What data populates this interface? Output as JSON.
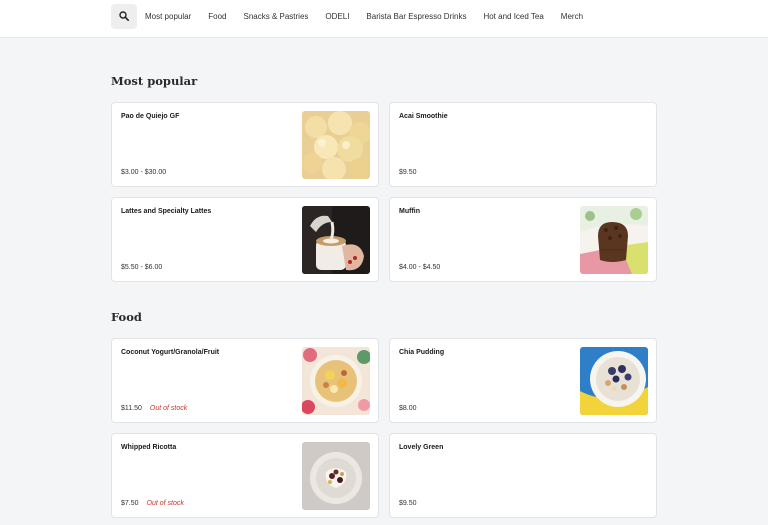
{
  "nav": {
    "items": [
      {
        "label": "Most popular"
      },
      {
        "label": "Food"
      },
      {
        "label": "Snacks & Pastries"
      },
      {
        "label": "ODELI"
      },
      {
        "label": "Barista Bar Espresso Drinks"
      },
      {
        "label": "Hot and Iced Tea"
      },
      {
        "label": "Merch"
      }
    ]
  },
  "sections": [
    {
      "title": "Most popular",
      "items": [
        {
          "name": "Pao de Quiejo GF",
          "price": "$3.00 - $30.00",
          "status": "",
          "image": "cheese-bread-photo"
        },
        {
          "name": "Acai Smoothie",
          "price": "$9.50",
          "status": "",
          "image": ""
        },
        {
          "name": "Lattes and Specialty Lattes",
          "price": "$5.50 - $6.00",
          "status": "",
          "image": "latte-photo"
        },
        {
          "name": "Muffin",
          "price": "$4.00 - $4.50",
          "status": "",
          "image": "muffin-photo"
        }
      ]
    },
    {
      "title": "Food",
      "items": [
        {
          "name": "Coconut Yogurt/Granola/Fruit",
          "price": "$11.50",
          "status": "Out of stock",
          "image": "yogurt-bowl-photo"
        },
        {
          "name": "Chia Pudding",
          "price": "$8.00",
          "status": "",
          "image": "chia-pudding-photo"
        },
        {
          "name": "Whipped Ricotta",
          "price": "$7.50",
          "status": "Out of stock",
          "image": "ricotta-photo"
        },
        {
          "name": "Lovely Green",
          "price": "$9.50",
          "status": "",
          "image": ""
        }
      ]
    }
  ],
  "colors": {
    "background": "#f4f5f7",
    "card": "#ffffff",
    "out_of_stock": "#c4372c"
  }
}
